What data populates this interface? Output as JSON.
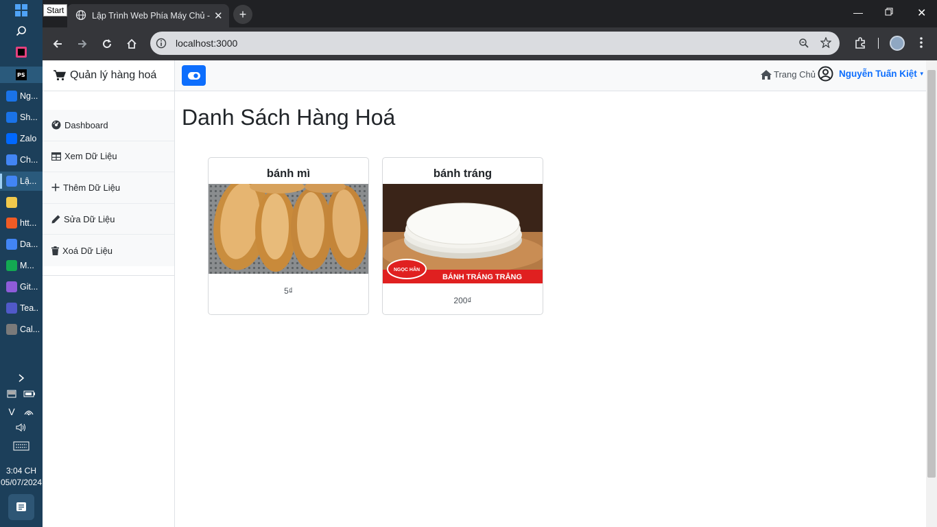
{
  "taskbar": {
    "start_tooltip": "Start",
    "apps": [
      {
        "label": "Ng...",
        "icon": "webstorm-icon",
        "color": "#1a73e8"
      },
      {
        "label": "Sh...",
        "icon": "webstorm-icon",
        "color": "#1a73e8"
      },
      {
        "label": "Zalo",
        "icon": "zalo-icon",
        "color": "#0068ff"
      },
      {
        "label": "Ch...",
        "icon": "chrome-icon",
        "color": "#4285f4"
      },
      {
        "label": "Lậ...",
        "icon": "chrome-icon",
        "color": "#4285f4"
      },
      {
        "label": "",
        "icon": "file-explorer-icon",
        "color": "#f2c94c"
      },
      {
        "label": "htt...",
        "icon": "postman-icon",
        "color": "#ef5b25"
      },
      {
        "label": "Da...",
        "icon": "chrome-icon",
        "color": "#4285f4"
      },
      {
        "label": "M...",
        "icon": "mongodb-icon",
        "color": "#13aa52"
      },
      {
        "label": "Git...",
        "icon": "github-desktop-icon",
        "color": "#8e5cd9"
      },
      {
        "label": "Tea...",
        "icon": "teams-icon",
        "color": "#5059c9"
      },
      {
        "label": "Cal...",
        "icon": "calculator-icon",
        "color": "#7a7a7a"
      }
    ],
    "time": "3:04 CH",
    "date": "05/07/2024"
  },
  "browser": {
    "tab_title": "Lập Trình Web Phía Máy Chủ - N",
    "url": "localhost:3000"
  },
  "app": {
    "brand": "Quản lý hàng hoá",
    "menu": [
      {
        "label": "Dashboard",
        "icon": "dashboard-icon"
      },
      {
        "label": "Xem Dữ Liệu",
        "icon": "table-icon"
      },
      {
        "label": "Thêm Dữ Liệu",
        "icon": "plus-icon"
      },
      {
        "label": "Sửa Dữ Liệu",
        "icon": "pencil-icon"
      },
      {
        "label": "Xoá Dữ Liệu",
        "icon": "trash-icon"
      }
    ],
    "nav_home": "Trang Chủ",
    "user_name": "Nguyễn Tuấn Kiệt",
    "page_title": "Danh Sách Hàng Hoá",
    "products": [
      {
        "name": "bánh mì",
        "price": "5₫"
      },
      {
        "name": "bánh tráng",
        "price": "200₫",
        "image_caption": "BÁNH TRÁNG TRẮNG",
        "brand_stamp": "NGỌC HÂN"
      }
    ]
  },
  "colors": {
    "primary": "#0d6efd",
    "taskbar": "#1c3f5a",
    "chrome_dark": "#202124"
  }
}
